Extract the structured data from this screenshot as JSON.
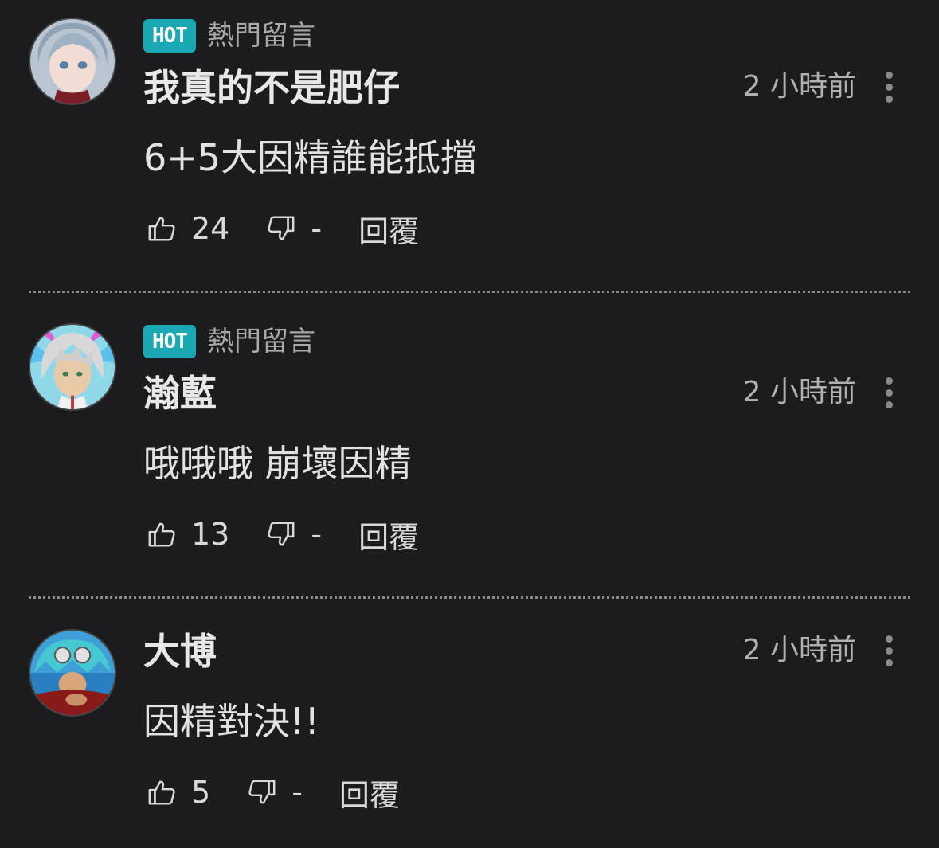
{
  "hot_badge": "HOT",
  "hot_label": "熱門留言",
  "comments": [
    {
      "username": "我真的不是肥仔",
      "time": "2 小時前",
      "text": "6+5大因精誰能抵擋",
      "likes": "24",
      "dislikes": "-",
      "reply": "回覆",
      "hot": true
    },
    {
      "username": "瀚藍",
      "time": "2 小時前",
      "text": "哦哦哦 崩壞因精",
      "likes": "13",
      "dislikes": "-",
      "reply": "回覆",
      "hot": true
    },
    {
      "username": "大博",
      "time": "2 小時前",
      "text": "因精對決!!",
      "likes": "5",
      "dislikes": "-",
      "reply": "回覆",
      "hot": false
    }
  ],
  "icons": {
    "like": "thumbs-up-icon",
    "dislike": "thumbs-down-icon",
    "more": "more-vertical-icon"
  },
  "colors": {
    "background": "#1c1c1e",
    "hot_badge": "#1aa9b4"
  }
}
